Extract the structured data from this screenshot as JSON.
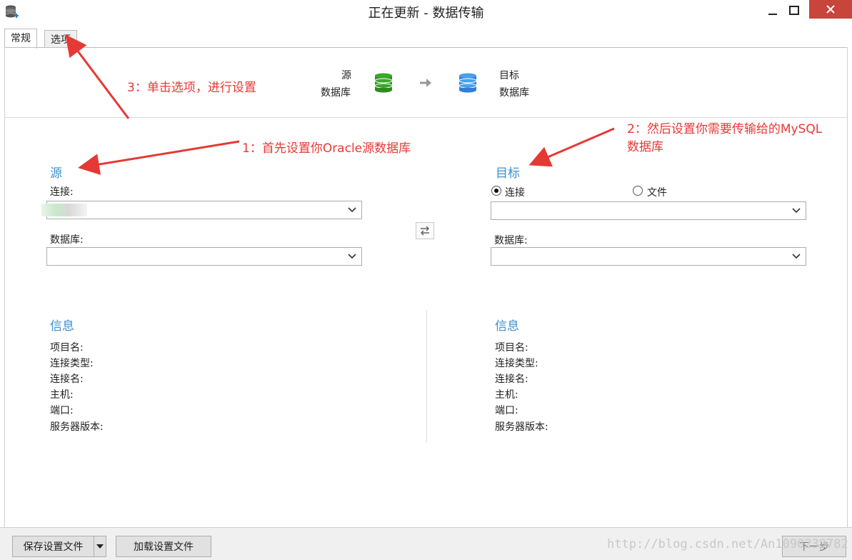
{
  "window": {
    "title": "正在更新 - 数据传输"
  },
  "tabs": [
    {
      "label": "常规"
    },
    {
      "label": "选项"
    }
  ],
  "flow": {
    "source_line1": "源",
    "source_line2": "数据库",
    "target_line1": "目标",
    "target_line2": "数据库"
  },
  "source": {
    "title": "源",
    "connection_label": "连接:",
    "database_label": "数据库:"
  },
  "target": {
    "title": "目标",
    "radio_connection": "连接",
    "radio_file": "文件",
    "database_label": "数据库:"
  },
  "info_left": {
    "title": "信息",
    "lines": [
      "项目名:",
      "连接类型:",
      "连接名:",
      "主机:",
      "端口:",
      "服务器版本:"
    ]
  },
  "info_right": {
    "title": "信息",
    "lines": [
      "项目名:",
      "连接类型:",
      "连接名:",
      "主机:",
      "端口:",
      "服务器版本:"
    ]
  },
  "buttons": {
    "save": "保存设置文件",
    "load": "加载设置文件",
    "next": "下一步"
  },
  "annotations": {
    "a3": "3：单击选项，进行设置",
    "a1": "1：首先设置你Oracle源数据库",
    "a2_line1": "2：然后设置你需要传输给的MySQL",
    "a2_line2": "数据库"
  },
  "watermark": "http://blog.csdn.net/An1090239782",
  "colors": {
    "accent": "#3b8fd0",
    "annotation": "#e53935",
    "close": "#c7453b"
  }
}
